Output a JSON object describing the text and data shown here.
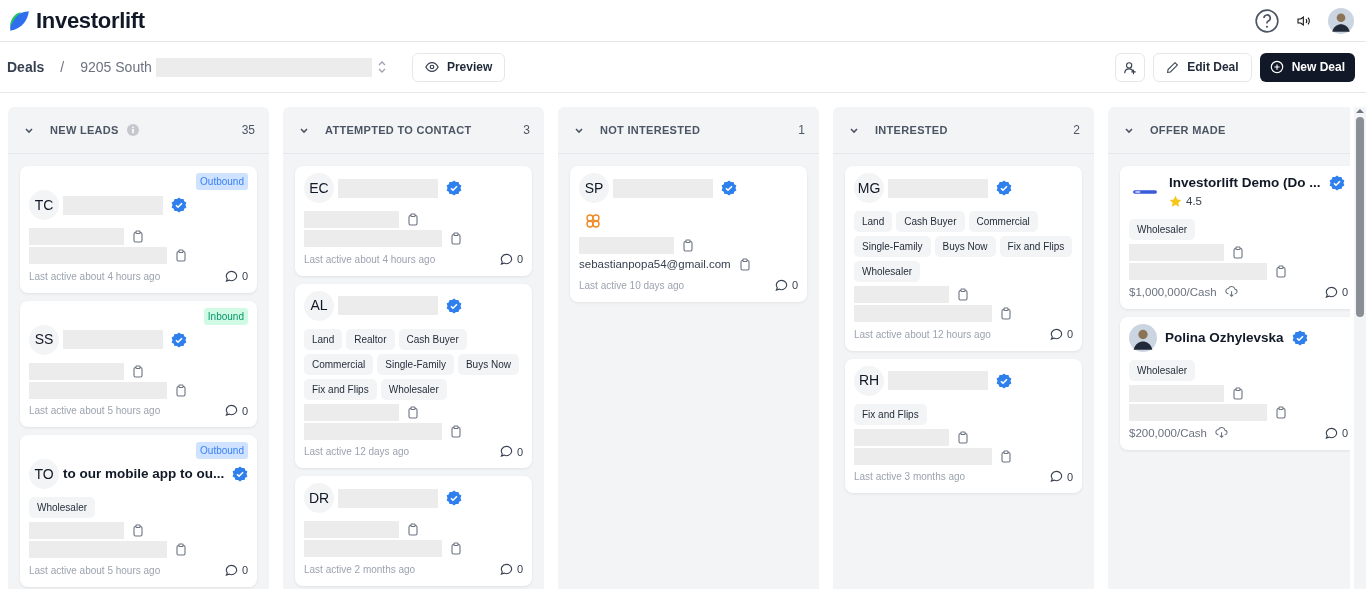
{
  "header": {
    "brand": "Investorlift"
  },
  "toolbar": {
    "breadcrumb_root": "Deals",
    "separator": "/",
    "deal_title": "9205 South",
    "preview_button": "Preview",
    "edit_button": "Edit Deal",
    "new_button": "New Deal"
  },
  "columns": [
    {
      "title": "NEW LEADS",
      "info": true,
      "count": "35",
      "expanded": true,
      "cards": [
        {
          "badge": {
            "label": "Outbound",
            "kind": "outbound"
          },
          "avatar": {
            "kind": "initials",
            "text": "TC"
          },
          "name": {
            "kind": "redacted"
          },
          "verified": true,
          "lines": [
            {
              "kind": "redacted"
            },
            {
              "kind": "redacted"
            }
          ],
          "footer": {
            "kind": "activity",
            "text": "Last active about 4 hours ago"
          },
          "comments": "0"
        },
        {
          "badge": {
            "label": "Inbound",
            "kind": "inbound"
          },
          "avatar": {
            "kind": "initials",
            "text": "SS"
          },
          "name": {
            "kind": "redacted"
          },
          "verified": true,
          "lines": [
            {
              "kind": "redacted"
            },
            {
              "kind": "redacted"
            }
          ],
          "footer": {
            "kind": "activity",
            "text": "Last active about 5 hours ago"
          },
          "comments": "0"
        },
        {
          "badge": {
            "label": "Outbound",
            "kind": "outbound"
          },
          "avatar": {
            "kind": "initials",
            "text": "TO"
          },
          "name": {
            "kind": "text",
            "text": "to our mobile app to ou..."
          },
          "verified": true,
          "tags": [
            "Wholesaler"
          ],
          "lines": [
            {
              "kind": "redacted"
            },
            {
              "kind": "redacted"
            }
          ],
          "footer": {
            "kind": "activity",
            "text": "Last active about 5 hours ago"
          },
          "comments": "0"
        }
      ]
    },
    {
      "title": "ATTEMPTED TO CONTACT",
      "info": false,
      "count": "3",
      "expanded": true,
      "cards": [
        {
          "avatar": {
            "kind": "initials",
            "text": "EC"
          },
          "name": {
            "kind": "redacted"
          },
          "verified": true,
          "lines": [
            {
              "kind": "redacted"
            },
            {
              "kind": "redacted"
            }
          ],
          "footer": {
            "kind": "activity",
            "text": "Last active about 4 hours ago"
          },
          "comments": "0"
        },
        {
          "avatar": {
            "kind": "initials",
            "text": "AL"
          },
          "name": {
            "kind": "redacted"
          },
          "verified": true,
          "tags": [
            "Land",
            "Realtor",
            "Cash Buyer",
            "Commercial",
            "Single-Family",
            "Buys Now",
            "Fix and Flips",
            "Wholesaler"
          ],
          "lines": [
            {
              "kind": "redacted"
            },
            {
              "kind": "redacted"
            }
          ],
          "footer": {
            "kind": "activity",
            "text": "Last active 12 days ago"
          },
          "comments": "0"
        },
        {
          "avatar": {
            "kind": "initials",
            "text": "DR"
          },
          "name": {
            "kind": "redacted"
          },
          "verified": true,
          "lines": [
            {
              "kind": "redacted"
            },
            {
              "kind": "redacted"
            }
          ],
          "footer": {
            "kind": "activity",
            "text": "Last active 2 months ago"
          },
          "comments": "0"
        }
      ]
    },
    {
      "title": "NOT INTERESTED",
      "info": false,
      "count": "1",
      "expanded": true,
      "cards": [
        {
          "avatar": {
            "kind": "initials",
            "text": "SP"
          },
          "name": {
            "kind": "redacted"
          },
          "verified": true,
          "lines": [
            {
              "kind": "icon"
            },
            {
              "kind": "redacted"
            },
            {
              "kind": "text",
              "text": "sebastianpopa54@gmail.com"
            }
          ],
          "footer": {
            "kind": "activity",
            "text": "Last active 10 days ago"
          },
          "comments": "0"
        }
      ]
    },
    {
      "title": "INTERESTED",
      "info": false,
      "count": "2",
      "expanded": true,
      "cards": [
        {
          "avatar": {
            "kind": "initials",
            "text": "MG"
          },
          "name": {
            "kind": "redacted"
          },
          "verified": true,
          "tags": [
            "Land",
            "Cash Buyer",
            "Commercial",
            "Single-Family",
            "Buys Now",
            "Fix and Flips",
            "Wholesaler"
          ],
          "lines": [
            {
              "kind": "redacted"
            },
            {
              "kind": "redacted"
            }
          ],
          "footer": {
            "kind": "activity",
            "text": "Last active about 12 hours ago"
          },
          "comments": "0"
        },
        {
          "avatar": {
            "kind": "initials",
            "text": "RH"
          },
          "name": {
            "kind": "redacted"
          },
          "verified": true,
          "tags": [
            "Fix and Flips"
          ],
          "lines": [
            {
              "kind": "redacted"
            },
            {
              "kind": "redacted"
            }
          ],
          "footer": {
            "kind": "activity",
            "text": "Last active 3 months ago"
          },
          "comments": "0"
        }
      ]
    },
    {
      "title": "OFFER MADE",
      "info": false,
      "expanded": true,
      "cards": [
        {
          "avatar": {
            "kind": "logo"
          },
          "name": {
            "kind": "text",
            "text": "Investorlift Demo (Do ..."
          },
          "rating": "4.5",
          "verified": true,
          "tags": [
            "Wholesaler"
          ],
          "lines": [
            {
              "kind": "redacted"
            },
            {
              "kind": "redacted"
            }
          ],
          "footer": {
            "kind": "price",
            "text": "$1,000,000/Cash"
          },
          "comments": "0"
        },
        {
          "avatar": {
            "kind": "photo"
          },
          "name": {
            "kind": "text",
            "text": "Polina Ozhylevska"
          },
          "verified": true,
          "tags": [
            "Wholesaler"
          ],
          "lines": [
            {
              "kind": "redacted"
            },
            {
              "kind": "redacted"
            }
          ],
          "footer": {
            "kind": "price",
            "text": "$200,000/Cash"
          },
          "comments": "0"
        }
      ]
    }
  ]
}
